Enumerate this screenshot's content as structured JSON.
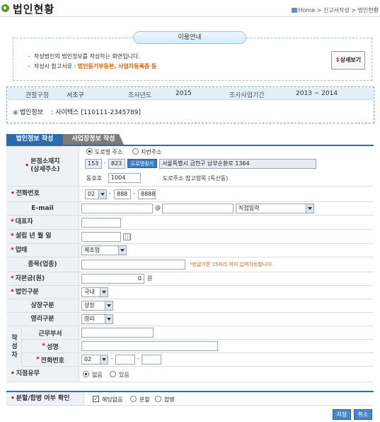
{
  "header": {
    "title": "법인현황",
    "breadcrumb": "Home > 신고서작성 > 법인현황"
  },
  "notice": {
    "tab_label": "이용안내",
    "line1": "작성법인의 법인정보를 작성하는 화면입니다.",
    "line2_prefix": "작성시 참고서류 : ",
    "line2_highlight": "법인등기부등본, 사업자등록증 등",
    "detail_button": "상세보기"
  },
  "summary": {
    "office_label": "관할구청",
    "office_value": "서초구",
    "year_label": "조사년도",
    "year_value": "2015",
    "period_label": "조사사업기간",
    "period_value": "2013 ~ 2014",
    "corp_label": "법인정보",
    "corp_value": ": 사이텍스 [110111-2345789]"
  },
  "tabs": {
    "active": "법인정보 작성",
    "inactive": "사업장정보 작성"
  },
  "form": {
    "address": {
      "label": "본점소재지\n(상세주소)",
      "opt_road": "도로명 주소",
      "opt_lot": "지번주소",
      "zip1": "153",
      "zip2": "823",
      "zip_button": "도로명찾기",
      "road_address": "서울특별시 금천구 남부순환로 1364",
      "dong_label": "동호호",
      "dong_value": "1004",
      "ref_label": "도로주소 참고항목 (독산동)"
    },
    "phone": {
      "label": "전화번호",
      "area": "02",
      "mid": "888",
      "last": "8888"
    },
    "email": {
      "label": "E-mail",
      "at": "@",
      "domain_select": "직접입력"
    },
    "ceo": {
      "label": "대표자"
    },
    "founded": {
      "label": "설립 년 월 일"
    },
    "business": {
      "label": "업태",
      "value": "제조업"
    },
    "item": {
      "label": "종목(업종)",
      "hint": "*한글기준 15자리 까지 입력가능합니다."
    },
    "capital": {
      "label": "자본금(원)",
      "value": "0",
      "unit": "원"
    },
    "corp_type": {
      "label": "법인구분",
      "value": "국내"
    },
    "listing": {
      "label": "상장구분",
      "value": "상장"
    },
    "profit": {
      "label": "영리구분",
      "value": "영리"
    },
    "writer": {
      "side_label": "작성자",
      "dept_label": "근무부서",
      "name_label": "성명",
      "phone_label": "전화번호",
      "phone_area": "02"
    },
    "branch": {
      "label": "지점유무",
      "opt_no": "없음",
      "opt_yes": "있음"
    },
    "merge": {
      "label": "분할/합병 여부 확인",
      "opt_none": "해당없음",
      "opt_split": "분할",
      "opt_merge": "합병"
    }
  },
  "buttons": {
    "save": "저장",
    "cancel": "취소"
  }
}
